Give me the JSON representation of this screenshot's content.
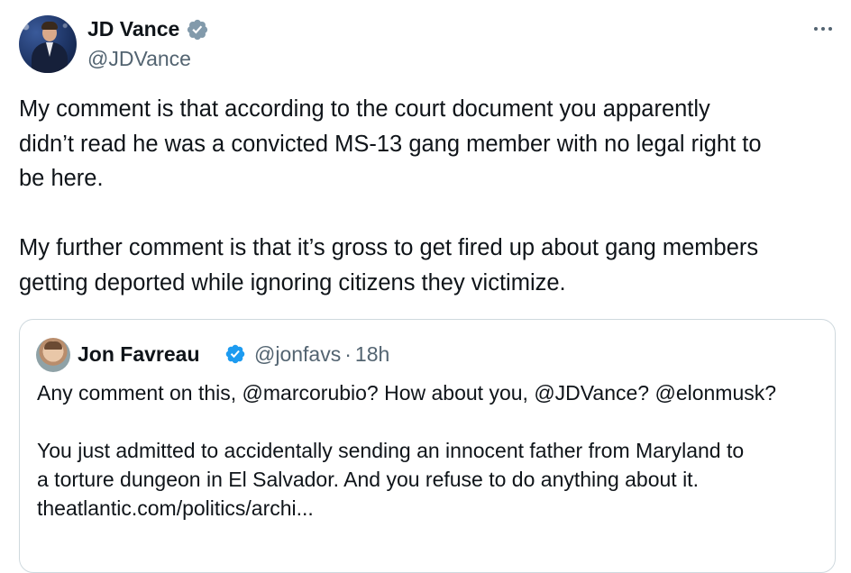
{
  "tweet": {
    "author_name": "JD Vance",
    "author_handle": "@JDVance",
    "verified_icon": "verified-badge-icon",
    "more_icon": "more-horizontal-icon",
    "paragraphs": [
      "My comment is that according to the court document you apparently\ndidn’t read he was a convicted MS-13 gang member with no legal right to\nbe here.",
      "My further comment is that it’s gross to get fired up about gang members\ngetting deported while ignoring citizens they victimize."
    ]
  },
  "quoted_tweet": {
    "author_name": "Jon Favreau",
    "author_handle": "@jonfavs",
    "separator": "·",
    "time": "18h",
    "verified_icon": "verified-badge-icon",
    "line1": "Any comment on this, @marcorubio? How about you, @JDVance? @elonmusk?",
    "line2": "You just admitted to accidentally sending an innocent father from Maryland to",
    "line3": "a torture dungeon in El Salvador. And you refuse to do anything about it.",
    "link": "theatlantic.com/politics/archi..."
  },
  "colors": {
    "text": "#0f1419",
    "secondary": "#536471",
    "verified": "#1d9bf0",
    "border": "#cfd9de"
  }
}
